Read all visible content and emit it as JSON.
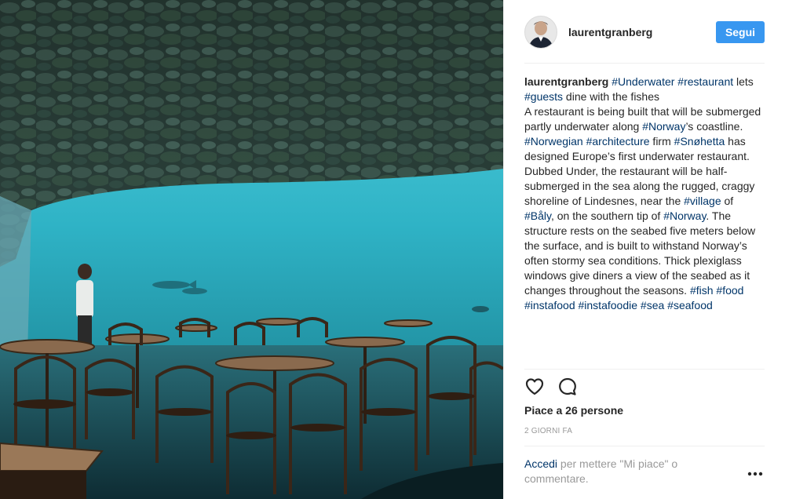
{
  "post": {
    "photo_alt": "Underwater restaurant interior",
    "header": {
      "username": "laurentgranberg",
      "follow_label": "Segui"
    },
    "caption": {
      "username": "laurentgranberg",
      "line1": [
        {
          "t": "tag",
          "v": "#Underwater"
        },
        {
          "t": "txt",
          "v": " "
        },
        {
          "t": "tag",
          "v": "#restaurant"
        },
        {
          "t": "txt",
          "v": " lets "
        },
        {
          "t": "tag",
          "v": "#guests"
        },
        {
          "t": "txt",
          "v": " dine with the fishes"
        }
      ],
      "para2": [
        {
          "t": "txt",
          "v": "A restaurant is being built that will be submerged partly underwater along "
        },
        {
          "t": "tag",
          "v": "#Norway"
        },
        {
          "t": "txt",
          "v": "’s coastline."
        }
      ],
      "para3": [
        {
          "t": "tag",
          "v": "#Norwegian"
        },
        {
          "t": "txt",
          "v": " "
        },
        {
          "t": "tag",
          "v": "#architecture"
        },
        {
          "t": "txt",
          "v": " firm "
        },
        {
          "t": "tag",
          "v": "#Snøhetta"
        },
        {
          "t": "txt",
          "v": " has designed Europe’s first underwater restaurant. Dubbed Under, the restaurant will be half-submerged in the sea along the rugged, craggy shoreline of Lindesnes, near the "
        },
        {
          "t": "tag",
          "v": "#village"
        },
        {
          "t": "txt",
          "v": " of "
        },
        {
          "t": "tag",
          "v": "#Båly"
        },
        {
          "t": "txt",
          "v": ", on the southern tip of "
        },
        {
          "t": "tag",
          "v": "#Norway"
        },
        {
          "t": "txt",
          "v": ". The structure rests on the seabed five meters below the surface, and is built to withstand Norway’s often stormy sea conditions. Thick plexiglass windows give diners a view of the seabed as it changes throughout the seasons. "
        },
        {
          "t": "tag",
          "v": "#fish"
        },
        {
          "t": "txt",
          "v": " "
        },
        {
          "t": "tag",
          "v": "#food"
        },
        {
          "t": "txt",
          "v": " "
        },
        {
          "t": "tag",
          "v": "#instafood"
        },
        {
          "t": "txt",
          "v": " "
        },
        {
          "t": "tag",
          "v": "#instafoodie"
        },
        {
          "t": "txt",
          "v": " "
        },
        {
          "t": "tag",
          "v": "#sea"
        },
        {
          "t": "txt",
          "v": " "
        },
        {
          "t": "tag",
          "v": "#seafood"
        }
      ]
    },
    "actions": {
      "like_icon": "heart-outline-icon",
      "comment_icon": "speech-bubble-icon"
    },
    "likes_text": "Piace a 26 persone",
    "date_text": "2 GIORNI FA",
    "login": {
      "link": "Accedi",
      "rest": " per mettere \"Mi piace\" o commentare."
    },
    "more_icon": "three-dots-icon"
  },
  "colors": {
    "follow_button": "#3897f0",
    "hashtag": "#003569",
    "muted": "#999999",
    "text": "#262626",
    "water": "#35b6c9"
  }
}
